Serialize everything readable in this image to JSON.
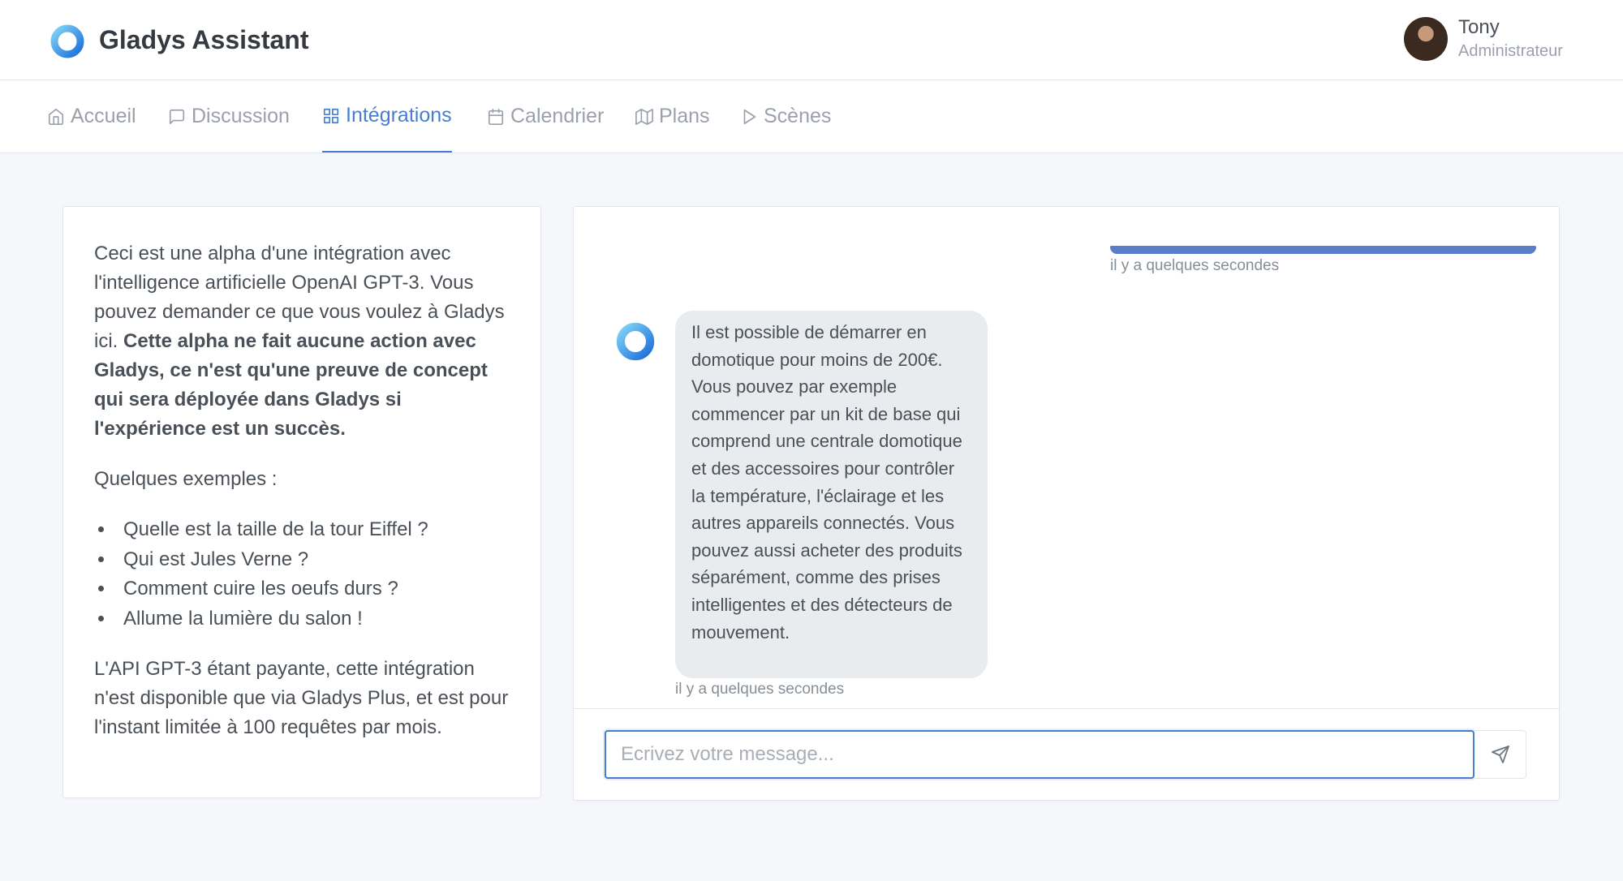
{
  "app": {
    "title": "Gladys Assistant",
    "user": {
      "name": "Tony",
      "role": "Administrateur"
    }
  },
  "nav": {
    "items": [
      {
        "label": "Accueil",
        "icon": "home-icon"
      },
      {
        "label": "Discussion",
        "icon": "message-square-icon"
      },
      {
        "label": "Intégrations",
        "icon": "grid-icon",
        "active": true
      },
      {
        "label": "Calendrier",
        "icon": "calendar-icon"
      },
      {
        "label": "Plans",
        "icon": "map-icon"
      },
      {
        "label": "Scènes",
        "icon": "play-icon"
      }
    ]
  },
  "info": {
    "intro": "Ceci est une alpha d'une intégration avec l'intelligence artificielle OpenAI GPT-3. Vous pouvez demander ce que vous voulez à Gladys ici. ",
    "intro_bold": "Cette alpha ne fait aucune action avec Gladys, ce n'est qu'une preuve de concept qui sera déployée dans Gladys si l'expérience est un succès.",
    "examples_title": "Quelques exemples :",
    "examples": [
      "Quelle est la taille de la tour Eiffel ?",
      "Qui est Jules Verne ?",
      "Comment cuire les oeufs durs ?",
      "Allume la lumière du salon !"
    ],
    "footer": "L'API GPT-3 étant payante, cette intégration n'est disponible que via Gladys Plus, et est pour l'instant limitée à 100 requêtes par mois."
  },
  "chat": {
    "user_message_time": "il y a quelques secondes",
    "bot_message": "Il est possible de démarrer en domotique pour moins de 200€. Vous pouvez par exemple commencer par un kit de base qui comprend une centrale domotique et des accessoires pour contrôler la température, l'éclairage et les autres appareils connectés. Vous pouvez aussi acheter des produits séparément, comme des prises intelligentes et des détecteurs de mouvement.",
    "bot_message_time": "il y a quelques secondes",
    "input_placeholder": "Ecrivez votre message...",
    "colors": {
      "accent": "#467fcf",
      "bubble": "#e9ecef",
      "user_bar": "#5b7ec8"
    }
  }
}
